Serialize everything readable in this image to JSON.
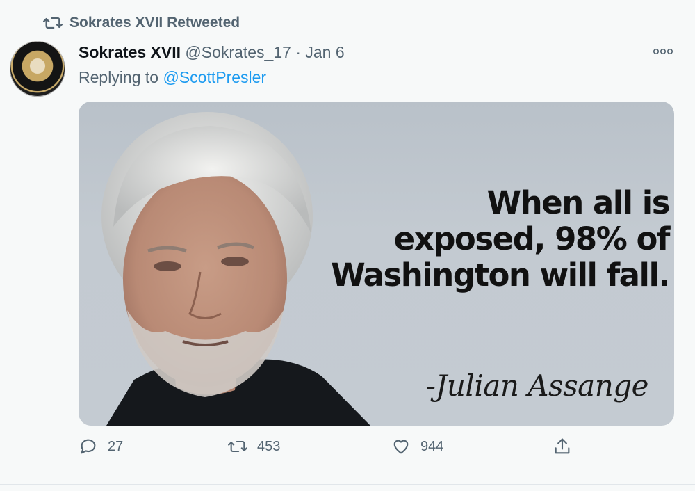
{
  "retweet": {
    "icon": "retweet-icon",
    "label": "Sokrates XVII Retweeted"
  },
  "author": {
    "name": "Sokrates XVII",
    "handle": "@Sokrates_17",
    "separator": "·",
    "date": "Jan 6"
  },
  "reply": {
    "prefix": "Replying to ",
    "target": "@ScottPresler"
  },
  "media": {
    "quote_lines": [
      "When all is",
      "exposed, 98% of",
      "Washington will fall."
    ],
    "attribution": "-Julian Assange"
  },
  "actions": {
    "replies": "27",
    "retweets": "453",
    "likes": "944"
  },
  "colors": {
    "accent": "#1d9bf0",
    "secondary_text": "#536471",
    "background": "#f7f9f9"
  }
}
